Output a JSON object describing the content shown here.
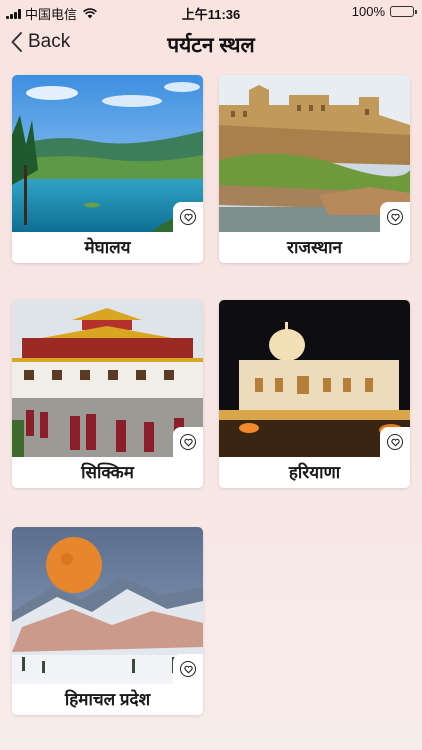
{
  "status_bar": {
    "carrier": "中国电信",
    "time": "上午11:36",
    "battery": "100%",
    "battery_level": 1.0
  },
  "nav": {
    "back_label": "Back",
    "title": "पर्यटन स्थल"
  },
  "places": [
    {
      "name": "मेघालय",
      "favorite_icon": "heart-outline-icon"
    },
    {
      "name": "राजस्थान",
      "favorite_icon": "heart-outline-icon"
    },
    {
      "name": "सिक्किम",
      "favorite_icon": "heart-outline-icon"
    },
    {
      "name": "हरियाणा",
      "favorite_icon": "heart-outline-icon"
    },
    {
      "name": "हिमाचल प्रदेश",
      "favorite_icon": "heart-outline-icon"
    }
  ],
  "colors": {
    "background": "#f8e6e3",
    "card": "#ffffff",
    "battery_fill": "#2ecc40"
  }
}
